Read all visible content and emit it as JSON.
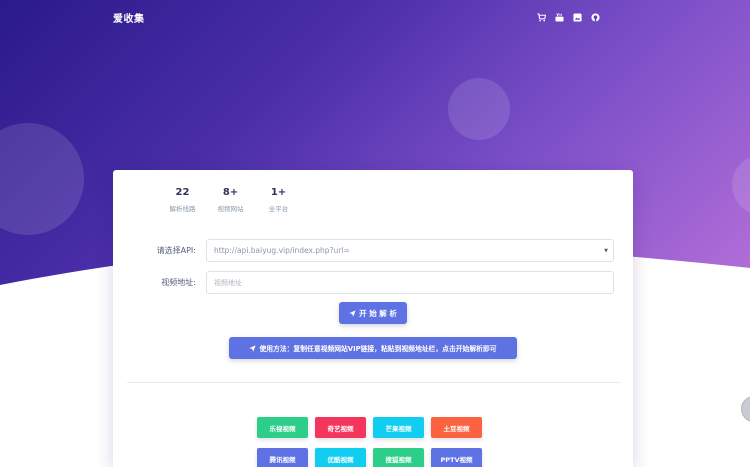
{
  "brand": "爱收集",
  "nav_icons": [
    "cart-icon",
    "youtube-icon",
    "image-icon",
    "github-icon"
  ],
  "stats": [
    {
      "value": "22",
      "label": "解析线路"
    },
    {
      "value": "8+",
      "label": "视频网站"
    },
    {
      "value": "1+",
      "label": "全平台"
    }
  ],
  "form": {
    "api_label": "请选择API:",
    "api_selected": "http://api.baiyug.vip/index.php?url=",
    "url_label": "视频地址:",
    "url_placeholder": "视频地址"
  },
  "buttons": {
    "parse": "开 始 解 析",
    "usage": "使用方法：复制任意视频网站VIP链接，粘贴到视频地址栏，点击开始解析即可"
  },
  "sites": [
    {
      "label": "乐视视频",
      "color": "#2dce89"
    },
    {
      "label": "奇艺视频",
      "color": "#f5365c"
    },
    {
      "label": "芒果视频",
      "color": "#11cdef"
    },
    {
      "label": "土豆视频",
      "color": "#fb6340"
    },
    {
      "label": "腾讯视频",
      "color": "#5e72e4"
    },
    {
      "label": "优酷视频",
      "color": "#11cdef"
    },
    {
      "label": "搜狐视频",
      "color": "#2dce89"
    },
    {
      "label": "PPTV视频",
      "color": "#5e72e4"
    }
  ],
  "colors": {
    "primary": "#5e72e4",
    "hero_start": "#2a1a8a",
    "hero_end": "#b46fd8"
  }
}
